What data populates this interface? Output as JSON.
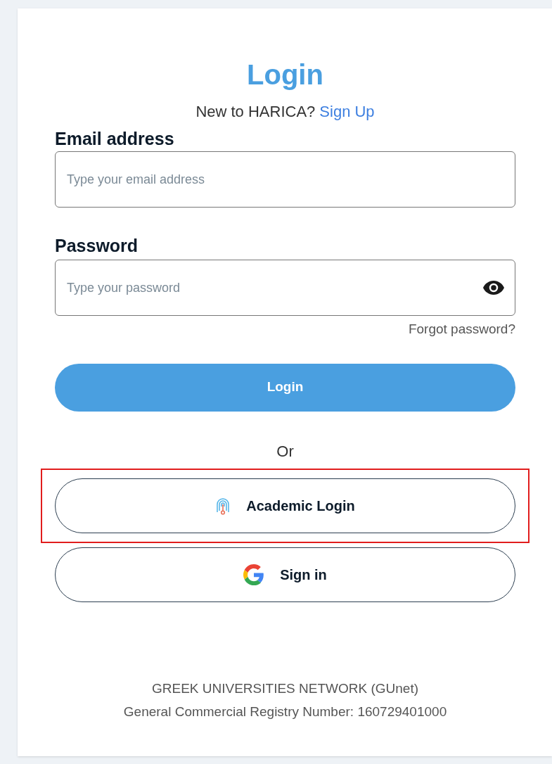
{
  "title": "Login",
  "signup": {
    "prompt": "New to HARICA?",
    "link": "Sign Up"
  },
  "email": {
    "label": "Email address",
    "placeholder": "Type your email address"
  },
  "password": {
    "label": "Password",
    "placeholder": "Type your password",
    "forgot": "Forgot password?"
  },
  "login_button": "Login",
  "separator": "Or",
  "alt_logins": [
    {
      "kind": "academic",
      "label": "Academic Login",
      "highlighted": true
    },
    {
      "kind": "google",
      "label": "Sign in",
      "highlighted": false
    }
  ],
  "footer": [
    "GREEK UNIVERSITIES NETWORK (GUnet)",
    "General Commercial Registry Number: 160729401000"
  ]
}
